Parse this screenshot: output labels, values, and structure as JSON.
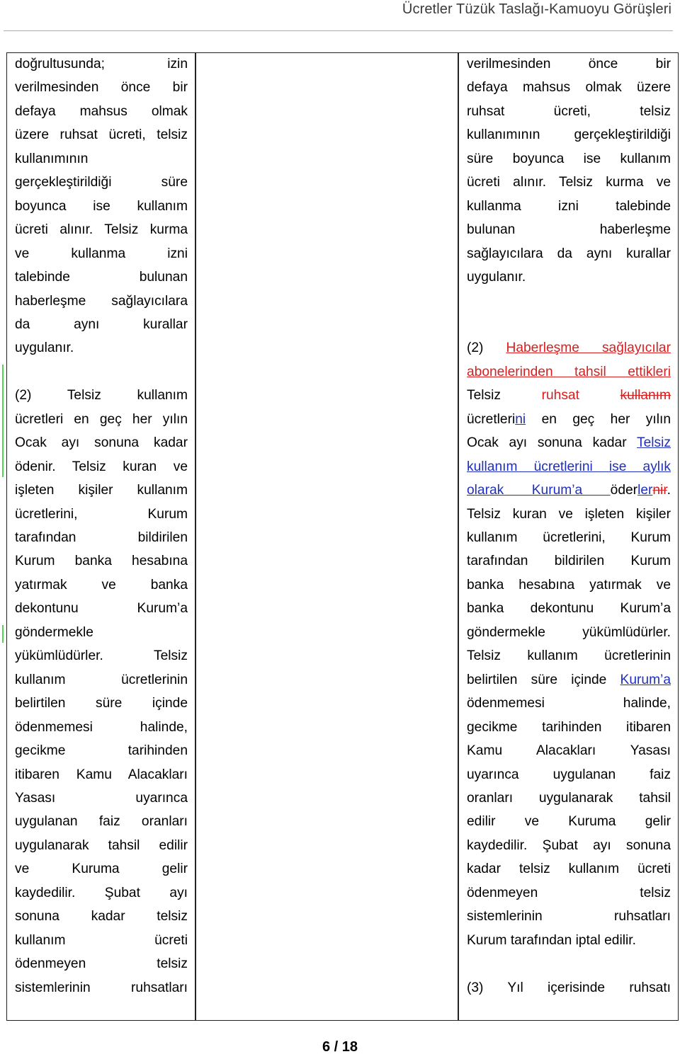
{
  "header": {
    "title": "Ücretler Tüzük Taslağı-Kamuoyu Görüşleri"
  },
  "table": {
    "left_column": {
      "lines": [
        {
          "text": "doğrultusunda; izin",
          "justify": true
        },
        {
          "text": "verilmesinden önce bir",
          "justify": true
        },
        {
          "text": "defaya mahsus olmak",
          "justify": true
        },
        {
          "text": "üzere ruhsat ücreti, telsiz",
          "justify": true
        },
        {
          "text": "kullanımının",
          "justify": false
        },
        {
          "text": "gerçekleştirildiği süre",
          "justify": true
        },
        {
          "text": "boyunca ise kullanım",
          "justify": true
        },
        {
          "text": "ücreti alınır. Telsiz kurma",
          "justify": true
        },
        {
          "text": "ve kullanma izni",
          "justify": true
        },
        {
          "text": "talebinde bulunan",
          "justify": true
        },
        {
          "text": "haberleşme sağlayıcılara",
          "justify": true
        },
        {
          "text": "da aynı kurallar",
          "justify": true
        },
        {
          "text": "uygulanır.",
          "justify": false
        },
        {
          "text": "",
          "justify": false
        },
        {
          "text": "(2) Telsiz kullanım",
          "justify": true
        },
        {
          "text": "ücretleri en geç her yılın",
          "justify": true
        },
        {
          "text": "Ocak ayı sonuna kadar",
          "justify": true
        },
        {
          "text": "ödenir. Telsiz kuran ve",
          "justify": true
        },
        {
          "text": "işleten kişiler kullanım",
          "justify": true
        },
        {
          "text": "ücretlerini, Kurum",
          "justify": true
        },
        {
          "text": "tarafından bildirilen",
          "justify": true
        },
        {
          "text": "Kurum banka hesabına",
          "justify": true
        },
        {
          "text": "yatırmak ve banka",
          "justify": true
        },
        {
          "text": "dekontunu Kurum’a",
          "justify": true
        },
        {
          "text": "göndermekle",
          "justify": false
        },
        {
          "text": "yükümlüdürler. Telsiz",
          "justify": true
        },
        {
          "text": "kullanım ücretlerinin",
          "justify": true
        },
        {
          "text": "belirtilen süre içinde",
          "justify": true
        },
        {
          "text": "ödenmemesi halinde,",
          "justify": true
        },
        {
          "text": "gecikme tarihinden",
          "justify": true
        },
        {
          "text": "itibaren Kamu Alacakları",
          "justify": true
        },
        {
          "text": "Yasası uyarınca",
          "justify": true
        },
        {
          "text": "uygulanan faiz oranları",
          "justify": true
        },
        {
          "text": "uygulanarak tahsil edilir",
          "justify": true
        },
        {
          "text": "ve Kuruma gelir",
          "justify": true
        },
        {
          "text": "kaydedilir. Şubat ayı",
          "justify": true
        },
        {
          "text": "sonuna kadar telsiz",
          "justify": true
        },
        {
          "text": "kullanım ücreti",
          "justify": true
        },
        {
          "text": "ödenmeyen telsiz",
          "justify": true
        },
        {
          "text": "sistemlerinin ruhsatları",
          "justify": true
        }
      ],
      "change_bars": [
        {
          "from_line": 14,
          "to_line": 18
        },
        {
          "from_line": 25,
          "to_line": 25
        }
      ]
    },
    "middle_column": {
      "lines": []
    },
    "right_column": {
      "lines": [
        {
          "justify": true,
          "segments": [
            {
              "text": "verilmesinden önce bir",
              "style": "normal"
            }
          ]
        },
        {
          "justify": true,
          "segments": [
            {
              "text": "defaya mahsus olmak üzere",
              "style": "normal"
            }
          ]
        },
        {
          "justify": true,
          "segments": [
            {
              "text": "ruhsat ücreti, telsiz",
              "style": "normal"
            }
          ]
        },
        {
          "justify": true,
          "segments": [
            {
              "text": "kullanımının gerçekleştirildiği",
              "style": "normal"
            }
          ]
        },
        {
          "justify": true,
          "segments": [
            {
              "text": "süre boyunca ise kullanım",
              "style": "normal"
            }
          ]
        },
        {
          "justify": true,
          "segments": [
            {
              "text": "ücreti alınır. Telsiz kurma ve",
              "style": "normal"
            }
          ]
        },
        {
          "justify": true,
          "segments": [
            {
              "text": "kullanma izni talebinde",
              "style": "normal"
            }
          ]
        },
        {
          "justify": true,
          "segments": [
            {
              "text": "bulunan haberleşme",
              "style": "normal"
            }
          ]
        },
        {
          "justify": true,
          "segments": [
            {
              "text": "sağlayıcılara da aynı kurallar",
              "style": "normal"
            }
          ]
        },
        {
          "justify": false,
          "segments": [
            {
              "text": "uygulanır.",
              "style": "normal"
            }
          ]
        },
        {
          "justify": false,
          "segments": []
        },
        {
          "justify": false,
          "segments": []
        },
        {
          "justify": true,
          "segments": [
            {
              "text": "(2) ",
              "style": "normal"
            },
            {
              "text": "Haberleşme sağlayıcılar",
              "style": "ins-red"
            }
          ]
        },
        {
          "justify": true,
          "segments": [
            {
              "text": "abonelerinden tahsil ettikleri",
              "style": "ins-red"
            }
          ]
        },
        {
          "justify": true,
          "segments": [
            {
              "text": "Telsiz ",
              "style": "normal"
            },
            {
              "text": "ruhsat ",
              "style": "red"
            },
            {
              "text": "kullanım",
              "style": "del-red"
            }
          ]
        },
        {
          "justify": true,
          "segments": [
            {
              "text": "ücretleri",
              "style": "normal"
            },
            {
              "text": "ni",
              "style": "ins-blue"
            },
            {
              "text": " en geç her yılın",
              "style": "normal"
            }
          ]
        },
        {
          "justify": true,
          "segments": [
            {
              "text": "Ocak ayı sonuna kadar ",
              "style": "normal"
            },
            {
              "text": "Telsiz",
              "style": "ins-blue"
            }
          ]
        },
        {
          "justify": true,
          "segments": [
            {
              "text": "kullanım ücretlerini ise aylık",
              "style": "ins-blue"
            }
          ]
        },
        {
          "justify": true,
          "segments": [
            {
              "text": "olarak Kurum’a ",
              "style": "ins-blue"
            },
            {
              "text": "öder",
              "style": "normal"
            },
            {
              "text": "ler",
              "style": "ins-blue"
            },
            {
              "text": "nir",
              "style": "del-red"
            },
            {
              "text": ".",
              "style": "normal"
            }
          ]
        },
        {
          "justify": true,
          "segments": [
            {
              "text": "Telsiz kuran ve işleten kişiler",
              "style": "normal"
            }
          ]
        },
        {
          "justify": true,
          "segments": [
            {
              "text": "kullanım ücretlerini, Kurum",
              "style": "normal"
            }
          ]
        },
        {
          "justify": true,
          "segments": [
            {
              "text": "tarafından bildirilen Kurum",
              "style": "normal"
            }
          ]
        },
        {
          "justify": true,
          "segments": [
            {
              "text": "banka hesabına yatırmak ve",
              "style": "normal"
            }
          ]
        },
        {
          "justify": true,
          "segments": [
            {
              "text": "banka dekontunu Kurum’a",
              "style": "normal"
            }
          ]
        },
        {
          "justify": true,
          "segments": [
            {
              "text": "göndermekle yükümlüdürler.",
              "style": "normal"
            }
          ]
        },
        {
          "justify": true,
          "segments": [
            {
              "text": "Telsiz kullanım ücretlerinin",
              "style": "normal"
            }
          ]
        },
        {
          "justify": true,
          "segments": [
            {
              "text": "belirtilen süre içinde ",
              "style": "normal"
            },
            {
              "text": "Kurum’a",
              "style": "ins-blue"
            }
          ]
        },
        {
          "justify": true,
          "segments": [
            {
              "text": "ödenmemesi halinde,",
              "style": "normal"
            }
          ]
        },
        {
          "justify": true,
          "segments": [
            {
              "text": "gecikme tarihinden itibaren",
              "style": "normal"
            }
          ]
        },
        {
          "justify": true,
          "segments": [
            {
              "text": "Kamu Alacakları Yasası",
              "style": "normal"
            }
          ]
        },
        {
          "justify": true,
          "segments": [
            {
              "text": "uyarınca uygulanan faiz",
              "style": "normal"
            }
          ]
        },
        {
          "justify": true,
          "segments": [
            {
              "text": "oranları uygulanarak tahsil",
              "style": "normal"
            }
          ]
        },
        {
          "justify": true,
          "segments": [
            {
              "text": "edilir ve Kuruma gelir",
              "style": "normal"
            }
          ]
        },
        {
          "justify": true,
          "segments": [
            {
              "text": "kaydedilir. Şubat ayı sonuna",
              "style": "normal"
            }
          ]
        },
        {
          "justify": true,
          "segments": [
            {
              "text": "kadar telsiz kullanım ücreti",
              "style": "normal"
            }
          ]
        },
        {
          "justify": true,
          "segments": [
            {
              "text": "ödenmeyen telsiz",
              "style": "normal"
            }
          ]
        },
        {
          "justify": true,
          "segments": [
            {
              "text": "sistemlerinin ruhsatları",
              "style": "normal"
            }
          ]
        },
        {
          "justify": false,
          "segments": [
            {
              "text": "Kurum tarafından iptal edilir.",
              "style": "normal"
            }
          ]
        },
        {
          "justify": false,
          "segments": []
        },
        {
          "justify": true,
          "segments": [
            {
              "text": "(3) Yıl içerisinde ruhsatı",
              "style": "normal"
            }
          ]
        }
      ]
    }
  },
  "footer": {
    "page_number": "6 / 18"
  },
  "colors": {
    "inserted_red": "#d81e1e",
    "inserted_blue": "#1f2fbf",
    "change_bar": "#4ddb4d",
    "header_rule": "#9fb0c4"
  }
}
